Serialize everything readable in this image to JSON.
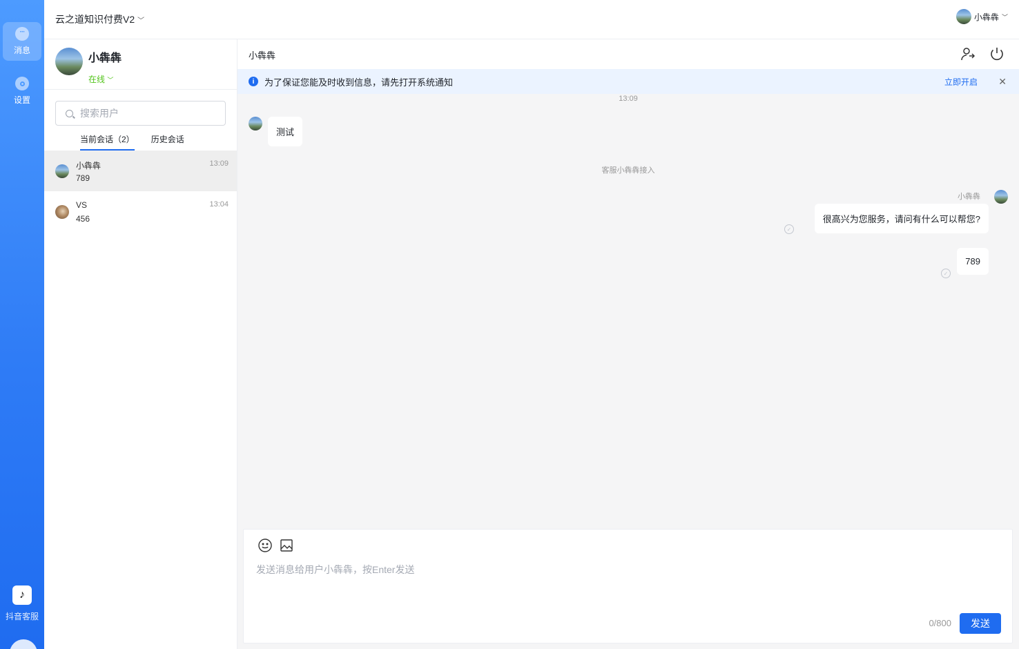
{
  "rail": {
    "items": [
      {
        "label": "消息",
        "icon": "message-icon"
      },
      {
        "label": "设置",
        "icon": "settings-icon"
      }
    ],
    "douyin": {
      "label": "抖音客服",
      "icon": "douyin-icon"
    }
  },
  "topbar": {
    "app_title": "云之道知识付费V2",
    "user_name": "小犇犇"
  },
  "profile": {
    "name": "小犇犇",
    "status": "在线"
  },
  "search": {
    "placeholder": "搜索用户"
  },
  "tabs": [
    {
      "label": "当前会话（2）",
      "active": true
    },
    {
      "label": "历史会话",
      "active": false
    }
  ],
  "sessions": [
    {
      "name": "小犇犇",
      "preview": "789",
      "time": "13:09"
    },
    {
      "name": "VS",
      "preview": "456",
      "time": "13:04"
    }
  ],
  "chat": {
    "title": "小犇犇",
    "notice": {
      "text": "为了保证您能及时收到信息，请先打开系统通知",
      "action": "立即开启"
    },
    "timestamp": "13:09",
    "incoming": {
      "text": "测试"
    },
    "system": "客服小犇犇接入",
    "agent_name": "小犇犇",
    "outgoing": [
      {
        "text": "很高兴为您服务，请问有什么可以帮您?"
      },
      {
        "text": "789"
      }
    ]
  },
  "composer": {
    "placeholder": "发送消息给用户小犇犇，按Enter发送",
    "counter": "0/800",
    "send_label": "发送"
  },
  "colors": {
    "accent": "#1f6cf0",
    "online": "#52c41a",
    "notice_bg": "#ebf3ff"
  }
}
